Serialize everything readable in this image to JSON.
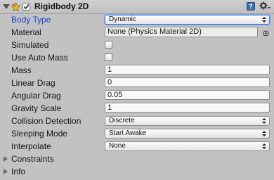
{
  "component": {
    "title": "Rigidbody 2D",
    "enabled": true
  },
  "icons": {
    "help": "help-book-icon",
    "settings": "gear-icon",
    "component": "rigidbody2d-icon",
    "object_picker": "object-picker-icon"
  },
  "properties": {
    "body_type": {
      "label": "Body Type",
      "value": "Dynamic"
    },
    "material": {
      "label": "Material",
      "value": "None (Physics Material 2D)"
    },
    "simulated": {
      "label": "Simulated",
      "checked": false
    },
    "use_auto_mass": {
      "label": "Use Auto Mass",
      "checked": false
    },
    "mass": {
      "label": "Mass",
      "value": "1"
    },
    "linear_drag": {
      "label": "Linear Drag",
      "value": "0"
    },
    "angular_drag": {
      "label": "Angular Drag",
      "value": "0.05"
    },
    "gravity_scale": {
      "label": "Gravity Scale",
      "value": "1"
    },
    "collision_detection": {
      "label": "Collision Detection",
      "value": "Discrete"
    },
    "sleeping_mode": {
      "label": "Sleeping Mode",
      "value": "Start Awake"
    },
    "interpolate": {
      "label": "Interpolate",
      "value": "None"
    }
  },
  "foldouts": {
    "constraints": {
      "label": "Constraints",
      "expanded": false
    },
    "info": {
      "label": "Info",
      "expanded": false
    }
  },
  "colors": {
    "background": "#c2c2c2",
    "active_label": "#2040c8",
    "focus_border": "#3d7be0"
  }
}
